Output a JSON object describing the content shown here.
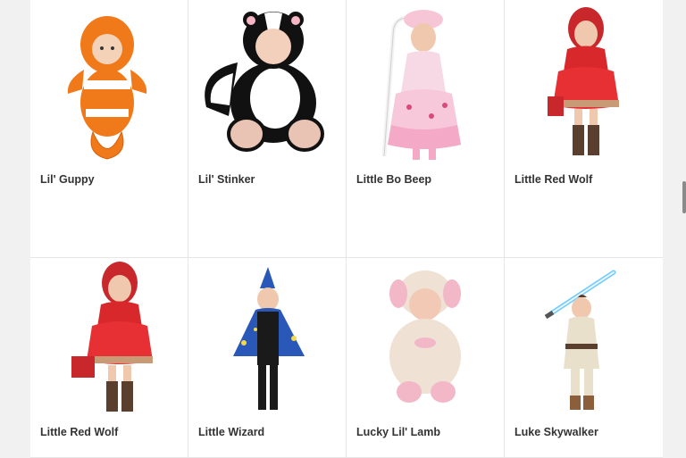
{
  "products": [
    {
      "name": "Lil' Guppy",
      "icon": "clownfish-baby-costume-image"
    },
    {
      "name": "Lil' Stinker",
      "icon": "skunk-baby-costume-image"
    },
    {
      "name": "Little Bo Beep",
      "icon": "bo-peep-girl-costume-image"
    },
    {
      "name": "Little Red Wolf",
      "icon": "red-riding-hood-costume-image"
    },
    {
      "name": "Little Red Wolf",
      "icon": "red-riding-hood-costume-image"
    },
    {
      "name": "Little Wizard",
      "icon": "wizard-boy-costume-image"
    },
    {
      "name": "Lucky Lil' Lamb",
      "icon": "lamb-baby-costume-image"
    },
    {
      "name": "Luke Skywalker",
      "icon": "luke-skywalker-costume-image"
    }
  ],
  "colors": {
    "text": "#333333",
    "border": "#e6e6e6",
    "background": "#f1f1f1"
  }
}
